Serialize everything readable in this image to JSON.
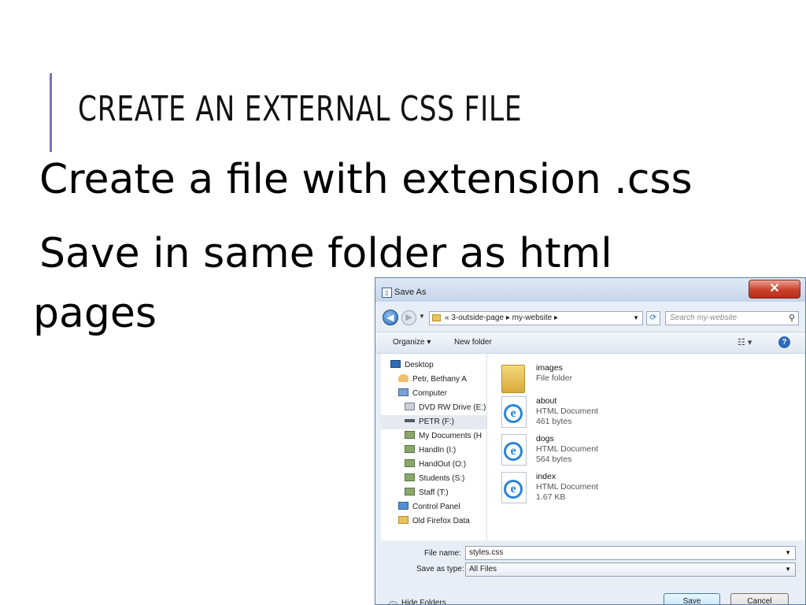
{
  "slide": {
    "title": "CREATE AN EXTERNAL CSS FILE",
    "bullet1": "Create a file with extension .css",
    "bullet2_line1": "Save in same folder as html",
    "bullet2_line2": "pages"
  },
  "dialog": {
    "title": "Save As",
    "close_glyph": "✕",
    "address": "«  3-outside-page  ▸  my-website  ▸",
    "search_placeholder": "Search my-website",
    "organize_label": "Organize ▾",
    "new_folder_label": "New folder",
    "view_glyph": "☷ ▾",
    "help_glyph": "?",
    "sidebar": [
      {
        "label": "Desktop",
        "icon": "desktop-icon"
      },
      {
        "label": "Petr, Bethany A",
        "icon": "user-icon"
      },
      {
        "label": "Computer",
        "icon": "computer-icon"
      },
      {
        "label": "DVD RW Drive (E:)",
        "icon": "dvd-drive-icon"
      },
      {
        "label": "PETR (F:)",
        "icon": "usb-drive-icon",
        "selected": true
      },
      {
        "label": "My Documents (H",
        "icon": "network-drive-icon"
      },
      {
        "label": "HandIn (I:)",
        "icon": "network-drive-icon"
      },
      {
        "label": "HandOut (O:)",
        "icon": "network-drive-icon"
      },
      {
        "label": "Students (S:)",
        "icon": "network-drive-icon"
      },
      {
        "label": "Staff (T:)",
        "icon": "network-drive-icon"
      },
      {
        "label": "Control Panel",
        "icon": "control-panel-icon"
      },
      {
        "label": "Old Firefox Data",
        "icon": "folder-icon"
      }
    ],
    "files": [
      {
        "name": "images",
        "type": "File folder",
        "size": "",
        "icon": "folder-icon"
      },
      {
        "name": "about",
        "type": "HTML Document",
        "size": "461 bytes",
        "icon": "ie-document-icon"
      },
      {
        "name": "dogs",
        "type": "HTML Document",
        "size": "564 bytes",
        "icon": "ie-document-icon"
      },
      {
        "name": "index",
        "type": "HTML Document",
        "size": "1.67 KB",
        "icon": "ie-document-icon"
      }
    ],
    "file_name_label": "File name:",
    "file_name_value": "styles.css",
    "save_as_type_label": "Save as type:",
    "save_as_type_value": "All Files",
    "hide_folders_label": "Hide Folders",
    "save_label": "Save",
    "cancel_label": "Cancel"
  }
}
